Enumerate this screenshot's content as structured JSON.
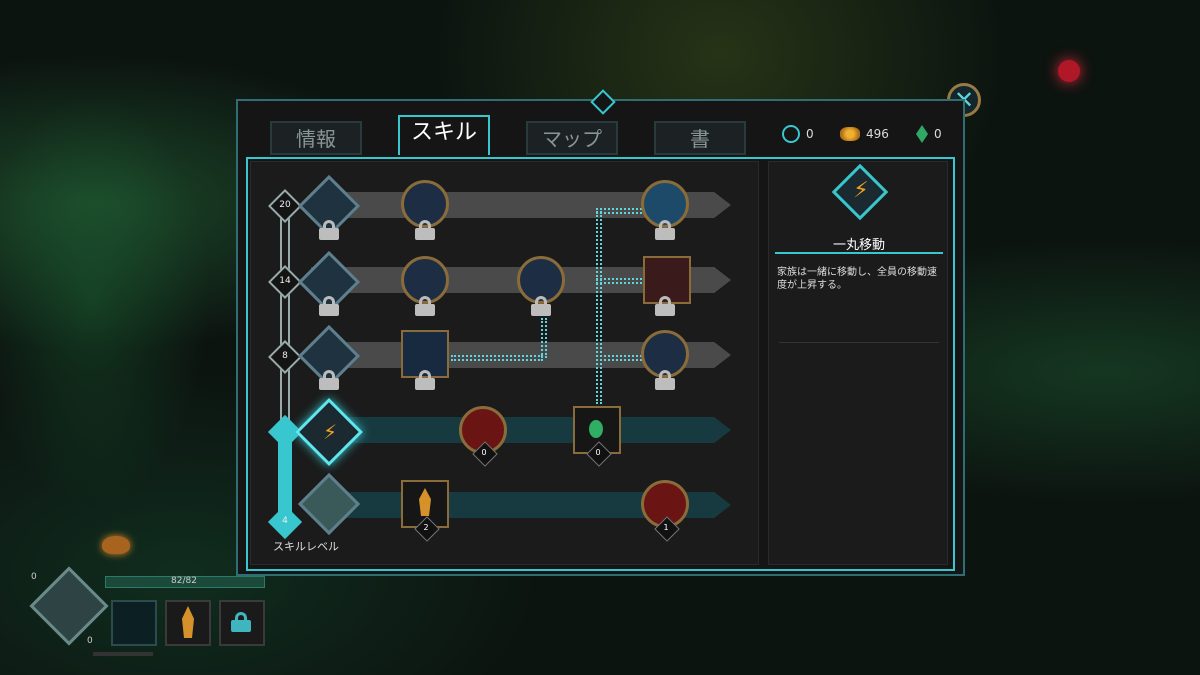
{
  "tabs": [
    "情報",
    "スキル",
    "マップ",
    "書"
  ],
  "active_tab": "スキル",
  "currency": {
    "gems": "0",
    "gold": "496",
    "shards": "0"
  },
  "skill_tree": {
    "levels": [
      "20",
      "14",
      "8",
      "4"
    ],
    "level_label": "スキルレベル",
    "counts": [
      "0",
      "0",
      "2",
      "1"
    ]
  },
  "skill_info": {
    "name": "一丸移動",
    "description": "家族は一緒に移動し、全員の移動速度が上昇する。"
  },
  "hud": {
    "hp": "82/82",
    "left_count_top": "0",
    "left_count_bottom": "0"
  },
  "colors": {
    "accent": "#38c7cf",
    "gold": "#e6a12a",
    "panel": "#151515"
  }
}
